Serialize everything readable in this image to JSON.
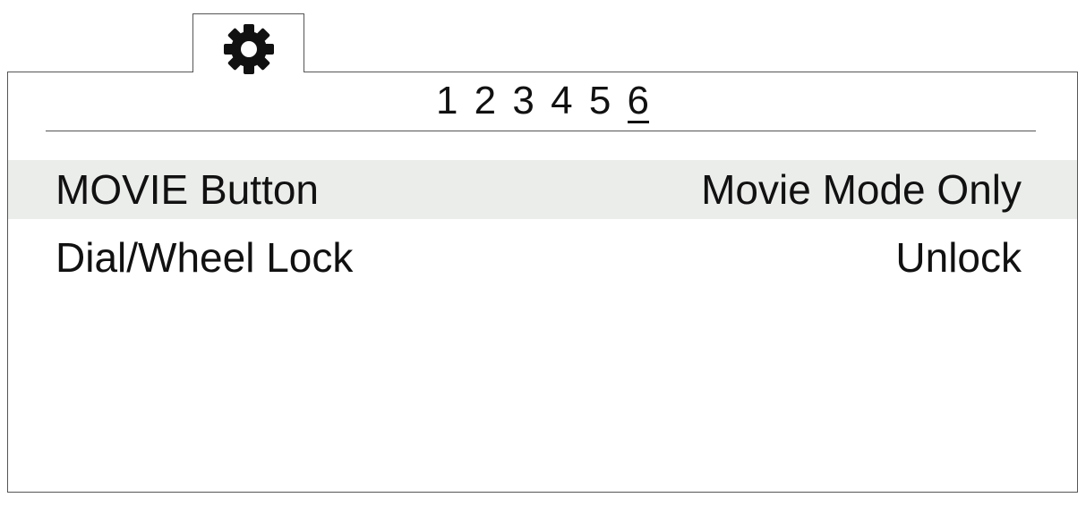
{
  "tab": {
    "icon": "gear-icon"
  },
  "pagination": {
    "pages": [
      "1",
      "2",
      "3",
      "4",
      "5",
      "6"
    ],
    "current_page": "6"
  },
  "menu": {
    "items": [
      {
        "label": "MOVIE Button",
        "value": "Movie Mode Only",
        "selected": true
      },
      {
        "label": "Dial/Wheel Lock",
        "value": "Unlock",
        "selected": false
      }
    ]
  },
  "colors": {
    "selection_background": "#ebedeb",
    "border": "#555555",
    "text": "#111111"
  }
}
